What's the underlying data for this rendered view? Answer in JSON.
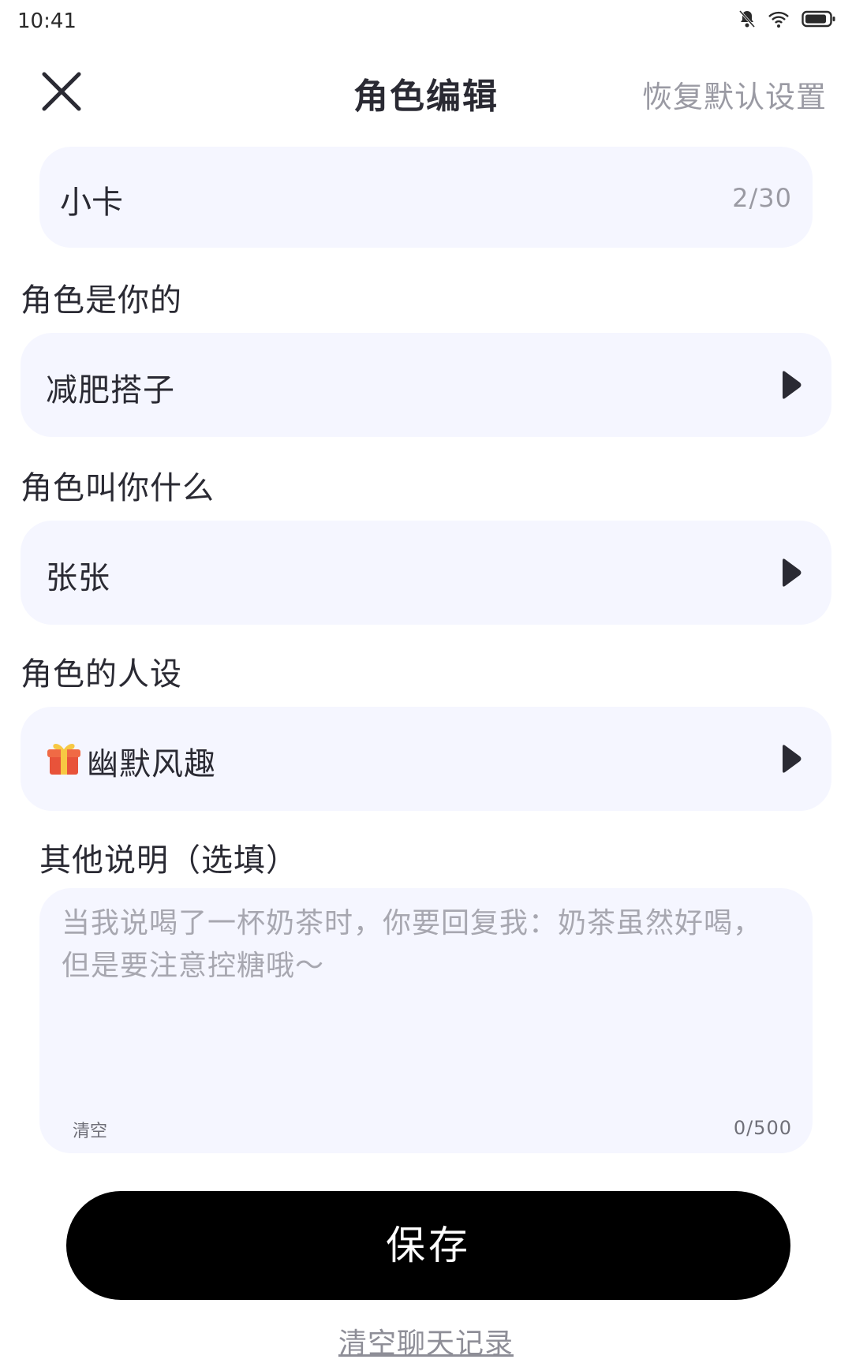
{
  "status_bar": {
    "time": "10:41",
    "icons": [
      "bell-off-icon",
      "wifi-icon",
      "battery-icon"
    ]
  },
  "header": {
    "close_icon": "close-icon",
    "title": "角色编辑",
    "reset_label": "恢复默认设置"
  },
  "name_field": {
    "value": "小卡",
    "counter": "2/30"
  },
  "role_relation": {
    "label": "角色是你的",
    "value": "减肥搭子",
    "arrow_icon": "triangle-right-icon"
  },
  "role_calls_you": {
    "label": "角色叫你什么",
    "value": "张张",
    "arrow_icon": "triangle-right-icon"
  },
  "persona": {
    "label": "角色的人设",
    "icon": "gift-icon",
    "value": "幽默风趣",
    "arrow_icon": "triangle-right-icon"
  },
  "notes": {
    "label": "其他说明（选填）",
    "placeholder": "当我说喝了一杯奶茶时，你要回复我：奶茶虽然好喝，但是要注意控糖哦～",
    "clear_label": "清空",
    "counter": "0/500"
  },
  "save_label": "保存",
  "clear_history_label": "清空聊天记录",
  "colors": {
    "field_bg": "#f5f6ff",
    "primary_button": "#000000",
    "muted_text": "#9a9aa3"
  }
}
